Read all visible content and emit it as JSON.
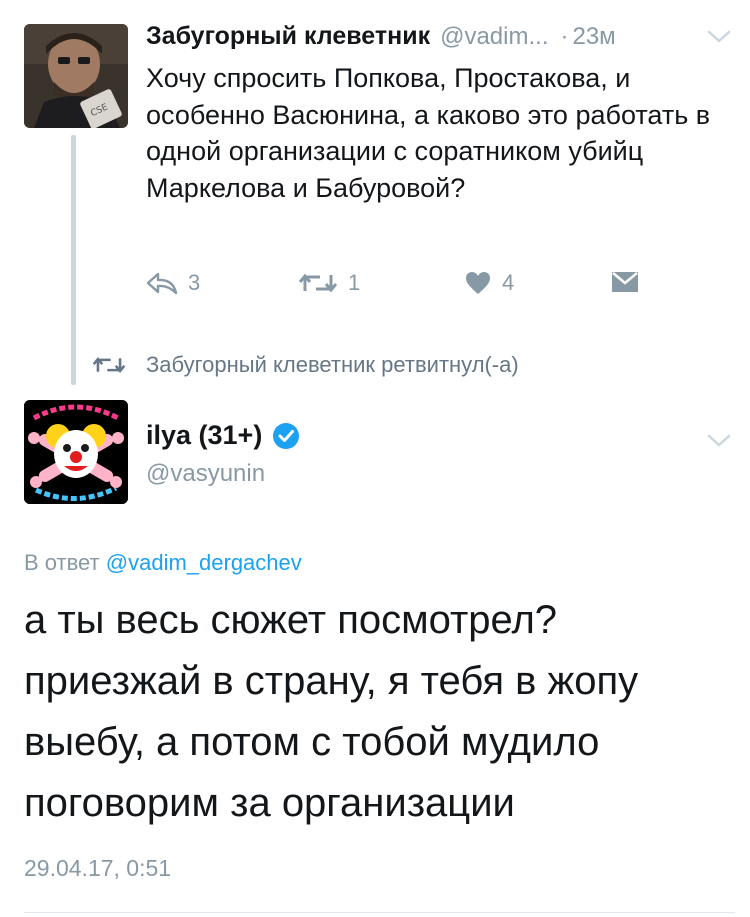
{
  "tweet1": {
    "author_name": "Забугорный клеветник",
    "handle": "@vadim...",
    "separator": "·",
    "time": "23м",
    "text": "Хочу спросить Попкова, Простакова, и особенно Васюнина, а каково это работать в одной организации с соратником убийц Маркелова и Бабуровой?",
    "actions": {
      "reply_count": "3",
      "retweet_count": "1",
      "like_count": "4"
    }
  },
  "retweet_notice": {
    "text": "Забугорный клеветник ретвитнул(-а)"
  },
  "tweet2": {
    "author_name": "ilya (31+)",
    "handle": "@vasyunin",
    "reply_prefix": "В ответ",
    "reply_mention": "@vadim_dergachev",
    "text": "а ты весь сюжет посмотрел? приезжай в страну, я тебя в жопу выебу, а потом с тобой мудило поговорим за организации",
    "timestamp": "29.04.17, 0:51"
  },
  "colors": {
    "link": "#1da1f2",
    "muted": "#8899a6",
    "text": "#14171a",
    "verified": "#1da1f2",
    "thread_line": "#ccd6dd"
  },
  "icons": [
    "reply-icon",
    "retweet-icon",
    "heart-icon",
    "direct-message-icon",
    "chevron-down-icon",
    "verified-badge-icon"
  ]
}
